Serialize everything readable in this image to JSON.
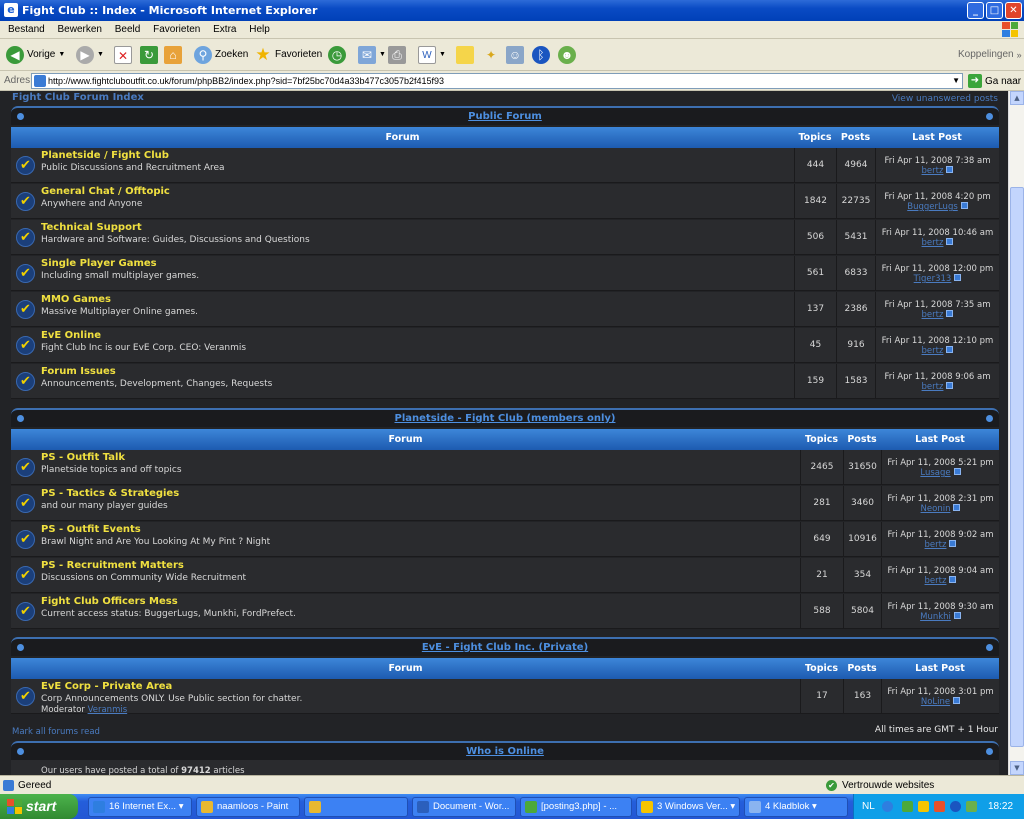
{
  "window": {
    "title": "Fight Club :: Index - Microsoft Internet Explorer"
  },
  "menu": [
    "Bestand",
    "Bewerken",
    "Beeld",
    "Favorieten",
    "Extra",
    "Help"
  ],
  "toolbar": {
    "back": "Vorige",
    "search": "Zoeken",
    "favorites": "Favorieten",
    "links": "Koppelingen"
  },
  "address": {
    "label": "Adres",
    "url": "http://www.fightcluboutfit.co.uk/forum/phpBB2/index.php?sid=7bf25bc70d4a33b477c3057b2f415f93",
    "go": "Ga naar"
  },
  "page": {
    "index_link": "Fight Club Forum Index",
    "unanswered": "View unanswered posts",
    "mark_read": "Mark all forums read",
    "timezone": "All times are GMT + 1 Hour"
  },
  "headers": {
    "forum": "Forum",
    "topics": "Topics",
    "posts": "Posts",
    "last_post": "Last Post"
  },
  "categories": [
    {
      "name": "Public Forum",
      "forums": [
        {
          "title": "Planetside / Fight Club",
          "desc": "Public Discussions and Recruitment Area",
          "topics": "444",
          "posts": "4964",
          "date": "Fri Apr 11, 2008 7:38 am",
          "user": "bertz"
        },
        {
          "title": "General Chat / Offtopic",
          "desc": "Anywhere and Anyone",
          "topics": "1842",
          "posts": "22735",
          "date": "Fri Apr 11, 2008 4:20 pm",
          "user": "BuggerLugs"
        },
        {
          "title": "Technical Support",
          "desc": "Hardware and Software: Guides, Discussions and Questions",
          "topics": "506",
          "posts": "5431",
          "date": "Fri Apr 11, 2008 10:46 am",
          "user": "bertz"
        },
        {
          "title": "Single Player Games",
          "desc": "Including small multiplayer games.",
          "topics": "561",
          "posts": "6833",
          "date": "Fri Apr 11, 2008 12:00 pm",
          "user": "Tiger313"
        },
        {
          "title": "MMO Games",
          "desc": "Massive Multiplayer Online games.",
          "topics": "137",
          "posts": "2386",
          "date": "Fri Apr 11, 2008 7:35 am",
          "user": "bertz"
        },
        {
          "title": "EvE Online",
          "desc": "Fight Club Inc is our EvE Corp. CEO: Veranmis",
          "topics": "45",
          "posts": "916",
          "date": "Fri Apr 11, 2008 12:10 pm",
          "user": "bertz"
        },
        {
          "title": "Forum Issues",
          "desc": "Announcements, Development, Changes, Requests",
          "topics": "159",
          "posts": "1583",
          "date": "Fri Apr 11, 2008 9:06 am",
          "user": "bertz"
        }
      ]
    },
    {
      "name": "Planetside - Fight Club (members only)",
      "forums": [
        {
          "title": "PS - Outfit Talk",
          "desc": "Planetside topics and off topics",
          "topics": "2465",
          "posts": "31650",
          "date": "Fri Apr 11, 2008 5:21 pm",
          "user": "Lusage"
        },
        {
          "title": "PS - Tactics & Strategies",
          "desc": "and our many player guides",
          "topics": "281",
          "posts": "3460",
          "date": "Fri Apr 11, 2008 2:31 pm",
          "user": "Neonin"
        },
        {
          "title": "PS - Outfit Events",
          "desc": "Brawl Night and Are You Looking At My Pint ? Night",
          "topics": "649",
          "posts": "10916",
          "date": "Fri Apr 11, 2008 9:02 am",
          "user": "bertz"
        },
        {
          "title": "PS - Recruitment Matters",
          "desc": "Discussions on Community Wide Recruitment",
          "topics": "21",
          "posts": "354",
          "date": "Fri Apr 11, 2008 9:04 am",
          "user": "bertz"
        },
        {
          "title": "Fight Club Officers Mess",
          "desc": "Current access status: BuggerLugs, Munkhi, FordPrefect.",
          "topics": "588",
          "posts": "5804",
          "date": "Fri Apr 11, 2008 9:30 am",
          "user": "Munkhi"
        }
      ]
    },
    {
      "name": "EvE - Fight Club Inc. (Private)",
      "forums": [
        {
          "title": "EvE Corp - Private Area",
          "desc": "Corp Announcements ONLY. Use Public section for chatter.",
          "moderator_label": "Moderator",
          "moderator": "Veranmis",
          "topics": "17",
          "posts": "163",
          "date": "Fri Apr 11, 2008 3:01 pm",
          "user": "NoLine"
        }
      ]
    }
  ],
  "online": {
    "title": "Who is Online",
    "text_pre": "Our users have posted a total of",
    "count": "97412",
    "text_post": "articles"
  },
  "status": {
    "text": "Gereed",
    "zone": "Vertrouwde websites"
  },
  "taskbar": {
    "start": "start",
    "tasks": [
      "16 Internet Ex...",
      "naamloos - Paint",
      "",
      "Document - Wor...",
      "[posting3.php] - ...",
      "3 Windows Ver...",
      "4 Kladblok"
    ],
    "lang": "NL",
    "clock": "18:22"
  },
  "colors": {
    "accent": "#4a7bc0",
    "title_yellow": "#f0e040",
    "bg": "#222326"
  }
}
